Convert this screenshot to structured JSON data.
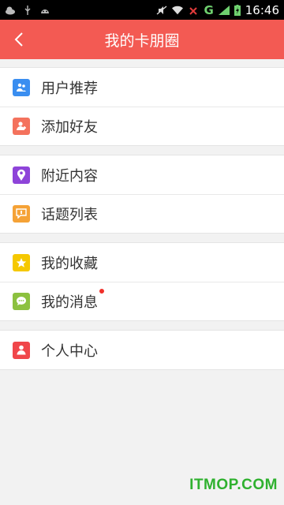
{
  "status_bar": {
    "network": "G",
    "time": "16:46",
    "icons": [
      "notification-cloud-icon",
      "usb-icon",
      "android-icon",
      "mute-icon",
      "wifi-icon",
      "no-signal-icon",
      "signal-icon",
      "battery-icon"
    ]
  },
  "header": {
    "title": "我的卡朋圈",
    "back_icon": "chevron-left-icon"
  },
  "menu_groups": [
    {
      "items": [
        {
          "label": "用户推荐",
          "icon": "users-icon",
          "color": "#3a8ef0"
        },
        {
          "label": "添加好友",
          "icon": "add-friend-icon",
          "color": "#f4725d"
        }
      ]
    },
    {
      "items": [
        {
          "label": "附近内容",
          "icon": "location-pin-icon",
          "color": "#8e44d9"
        },
        {
          "label": "话题列表",
          "icon": "topic-icon",
          "color": "#f5a236"
        }
      ]
    },
    {
      "items": [
        {
          "label": "我的收藏",
          "icon": "star-icon",
          "color": "#f5c800"
        },
        {
          "label": "我的消息",
          "icon": "chat-bubble-icon",
          "color": "#8cc13f",
          "has_badge": true
        }
      ]
    },
    {
      "items": [
        {
          "label": "个人中心",
          "icon": "person-icon",
          "color": "#f0464a"
        }
      ]
    }
  ],
  "watermark": "ITMOP.COM",
  "colors": {
    "header_bg": "#f35a53",
    "page_bg": "#f2f2f2",
    "badge": "#f0302a"
  }
}
